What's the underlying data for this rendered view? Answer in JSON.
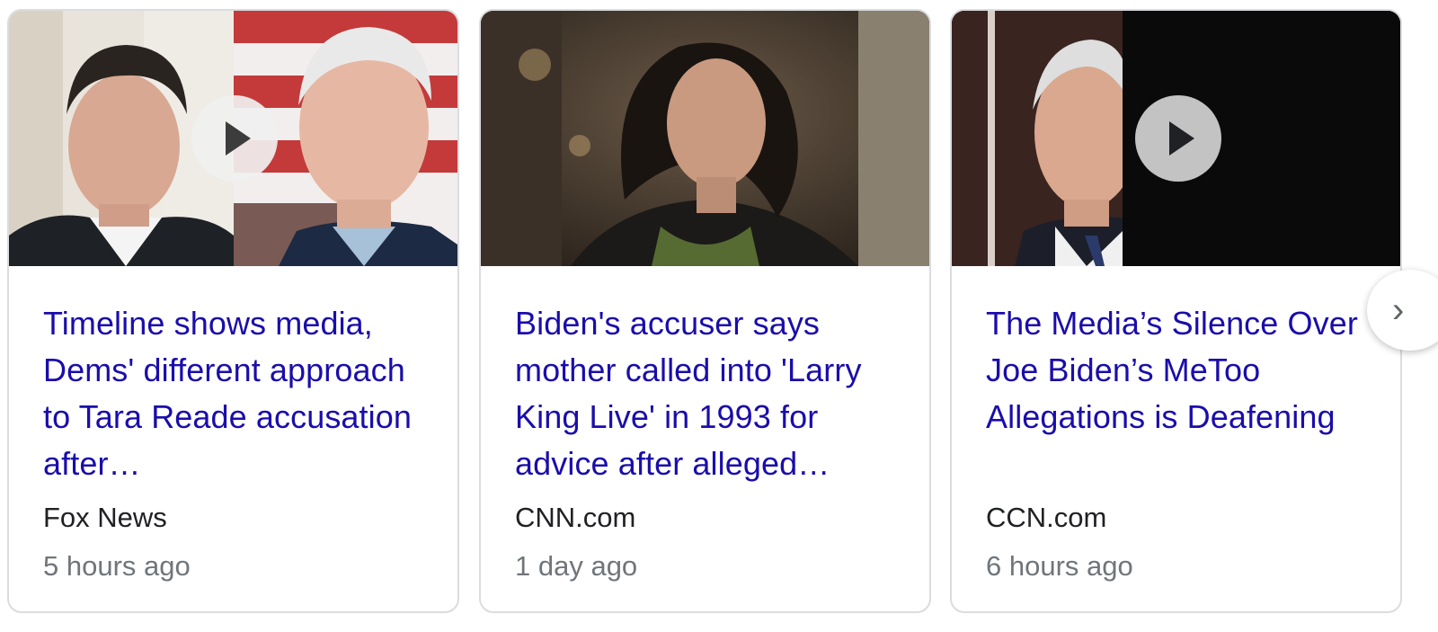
{
  "cards": [
    {
      "title": "Timeline shows media, Dems' different approach to Tara Reade accusation after…",
      "source": "Fox News",
      "time": "5 hours ago",
      "has_video": true
    },
    {
      "title": "Biden's accuser says mother called into 'Larry King Live' in 1993 for advice after alleged…",
      "source": "CNN.com",
      "time": "1 day ago",
      "has_video": false
    },
    {
      "title": "The Media’s Silence Over Joe Biden’s MeToo Allegations is Deafening",
      "source": "CCN.com",
      "time": "6 hours ago",
      "has_video": true
    }
  ],
  "navigation": {
    "next_icon": "chevron-right-icon",
    "next_glyph": "›"
  },
  "colors": {
    "title_link": "#1a0dab",
    "source_text": "#202124",
    "time_text": "#70757a",
    "card_border": "#dadce0"
  }
}
